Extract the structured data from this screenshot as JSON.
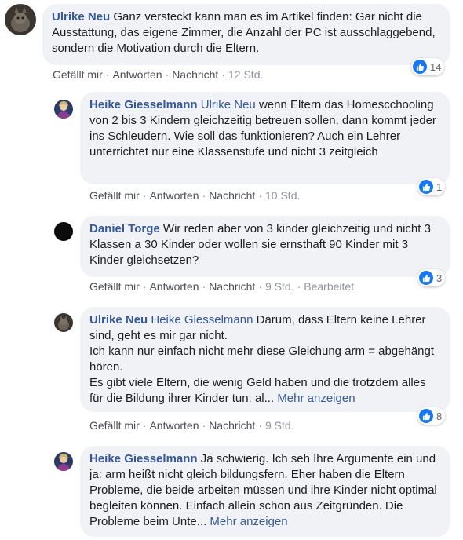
{
  "colors": {
    "bubble": "#f0f2f5",
    "author": "#385898",
    "like": "#1877f2",
    "meta": "#90949c"
  },
  "comments": [
    {
      "author": "Ulrike Neu",
      "mention": "",
      "text": "Ganz versteckt kann man es im Artikel finden: Gar nicht die Ausstattung, das eigene Zimmer, die Anzahl der PC ist ausschlaggebend, sondern die Motivation durch die Eltern.",
      "more": "",
      "actions": {
        "like": "Gefällt mir",
        "reply": "Antworten",
        "message": "Nachricht",
        "time": "12 Std.",
        "edited": ""
      },
      "reaction_icon": "like-icon",
      "reaction_count": "14"
    },
    {
      "author": "Heike Giesselmann",
      "mention": "Ulrike Neu",
      "text": "wenn Eltern das Homescchooling von 2 bis 3 Kindern gleichzeitig betreuen sollen, dann kommt jeder ins Schleudern. Wie soll das funktionieren? Auch ein Lehrer unterrichtet nur eine Klassenstufe und nicht 3 zeitgleich",
      "more": "",
      "actions": {
        "like": "Gefällt mir",
        "reply": "Antworten",
        "message": "Nachricht",
        "time": "10 Std.",
        "edited": ""
      },
      "reaction_icon": "like-icon",
      "reaction_count": "1"
    },
    {
      "author": "Daniel Torge",
      "mention": "",
      "text": "Wir reden aber von 3 kinder gleichzeitig und nicht 3 Klassen a 30 Kinder oder wollen sie ernsthaft 90 Kinder mit 3 Kinder gleichsetzen?",
      "more": "",
      "actions": {
        "like": "Gefällt mir",
        "reply": "Antworten",
        "message": "Nachricht",
        "time": "9 Std.",
        "edited": "Bearbeitet"
      },
      "reaction_icon": "like-icon",
      "reaction_count": "3"
    },
    {
      "author": "Ulrike Neu",
      "mention": "Heike Giesselmann",
      "text": "Darum, dass Eltern keine Lehrer sind, geht es mir gar nicht.",
      "text2": "Ich kann nur einfach nicht mehr diese Gleichung arm = abgehängt hören.",
      "text3": "Es gibt viele Eltern, die wenig Geld haben und die trotzdem alles für die Bildung ihrer Kinder tun: al...",
      "more": "Mehr anzeigen",
      "actions": {
        "like": "Gefällt mir",
        "reply": "Antworten",
        "message": "Nachricht",
        "time": "9 Std.",
        "edited": ""
      },
      "reaction_icon": "like-icon",
      "reaction_count": "8"
    },
    {
      "author": "Heike Giesselmann",
      "mention": "",
      "text": "Ja schwierig. Ich seh Ihre Argumente ein und ja: arm heißt nicht gleich bildungsfern. Eher haben die Eltern Probleme, die beide arbeiten müssen und ihre Kinder nicht optimal begleiten können. Einfach allein schon aus Zeitgründen. Die Probleme beim Unte...",
      "more": "Mehr anzeigen"
    }
  ]
}
